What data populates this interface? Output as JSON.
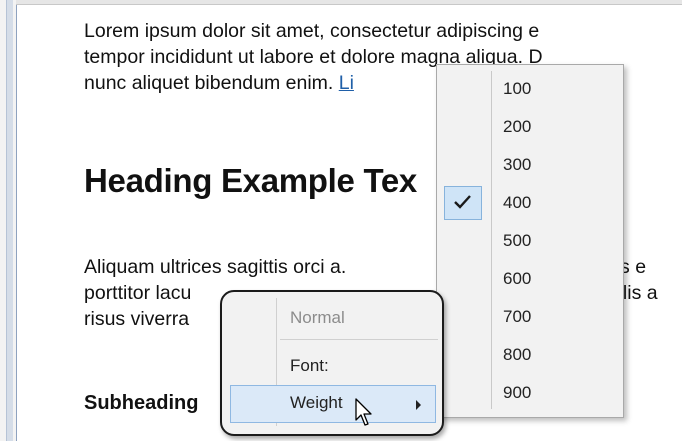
{
  "document": {
    "paragraph1": [
      {
        "text": "Lorem ipsum dolor sit amet, consectetur adipiscing e"
      },
      {
        "text": "tempor incididunt ut labore et dolore magna aliqua. D"
      },
      {
        "text": "nunc aliquet bibendum enim. ",
        "link": "Li"
      }
    ],
    "heading": "Heading Example Tex",
    "paragraph2": [
      {
        "text": "Aliquam ultrices sagittis orci a.",
        "tail": "quis e"
      },
      {
        "text": "porttitor lacu",
        "tail": "vallis a"
      },
      {
        "text": "risus viverra",
        "tail": ""
      }
    ],
    "subheading": "Subheading"
  },
  "weight_submenu": {
    "items": [
      "100",
      "200",
      "300",
      "400",
      "500",
      "600",
      "700",
      "800",
      "900"
    ],
    "checked": "400"
  },
  "context_menu": {
    "items": [
      {
        "label": "Normal",
        "state": "disabled"
      },
      {
        "label": "Font:",
        "state": "normal"
      },
      {
        "label": "Weight",
        "state": "hover",
        "has_submenu": true
      }
    ]
  },
  "colors": {
    "link": "#1f5fa8",
    "hover_bg": "#dbe9f8",
    "check_bg": "#cfe4f7"
  }
}
